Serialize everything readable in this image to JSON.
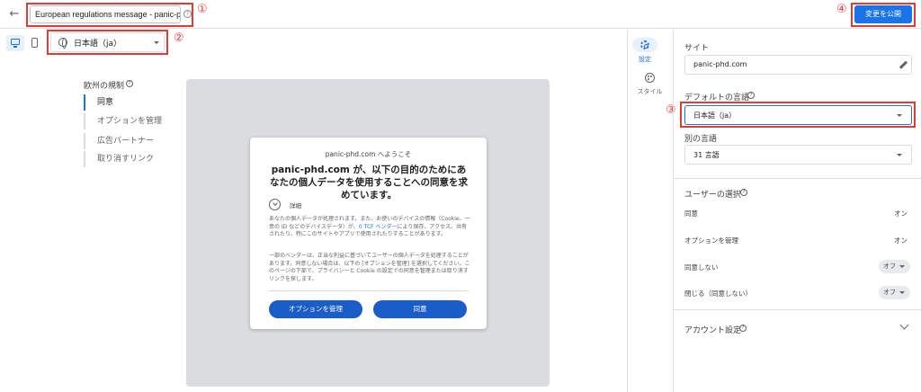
{
  "header": {
    "message_title": "European regulations message - panic-p",
    "help_glyph": "?",
    "publish_label": "変更を公開",
    "back_glyph": "←"
  },
  "markers": {
    "m1": "①",
    "m2": "②",
    "m3": "③",
    "m4": "④"
  },
  "toolbar": {
    "preview_language": "日本語（ja）"
  },
  "left_nav": {
    "title": "欧州の規制",
    "help_glyph": "?",
    "items": [
      "同意",
      "オプションを管理",
      "広告パートナー",
      "取り消すリンク"
    ]
  },
  "dialog": {
    "welcome": "panic-phd.com へようこそ",
    "heading": "panic-phd.com が、以下の目的のためにあなたの個人データを使用することへの同意を求めています。",
    "details_label": "詳細",
    "para1_pre": "あなたの個人データが処理されます。また、お使いのデバイスの情報（Cookie、一意の ID などのデバイスデータ）が、",
    "para1_link": "0 TCF ベンダー",
    "para1_post": "により保存、アクセス、共有されたり、特にこのサイトやアプリで使用されたりすることがあります。",
    "para2": "一部のベンダーは、正当な利益に基づいてユーザーの個人データを処理することがあります。同意しない場合は、以下の [オプションを管理] を選択してください。このページの下部で、プライバシーと Cookie の設定での同意を管理または取り消すリンクを探します。",
    "manage_button": "オプションを管理",
    "consent_button": "同意"
  },
  "side_rail": {
    "settings_label": "設定",
    "style_label": "スタイル"
  },
  "settings": {
    "site_label": "サイト",
    "site_value": "panic-phd.com",
    "default_lang_label": "デフォルトの言語",
    "default_lang_value": "日本語（ja）",
    "other_lang_label": "別の言語",
    "other_lang_value": "31 言語",
    "user_choice_label": "ユーザーの選択",
    "choices": [
      {
        "label": "同意",
        "value": "オン"
      },
      {
        "label": "オプションを管理",
        "value": "オン"
      },
      {
        "label": "同意しない",
        "value": "オフ"
      },
      {
        "label": "閉じる（同意しない）",
        "value": "オフ"
      }
    ],
    "account_label": "アカウント設定"
  },
  "colors": {
    "accent": "#1a73e8",
    "annotation_red": "#e53935",
    "canvas_gray": "#dadce0"
  }
}
